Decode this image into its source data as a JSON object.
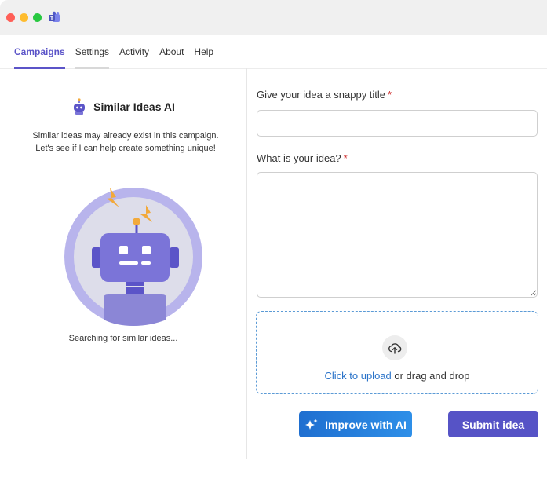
{
  "colors": {
    "accent": "#5b54c8",
    "background_brand": "#5b4fc7",
    "traffic_red": "#ff5f57",
    "traffic_yellow": "#febc2e",
    "traffic_green": "#28c840",
    "ai_button": "#1f6fd0",
    "submit_button": "#5653c6",
    "required": "#cc2222"
  },
  "tabs": [
    {
      "label": "Campaigns",
      "active": true
    },
    {
      "label": "Settings",
      "active": false
    },
    {
      "label": "Activity",
      "active": false
    },
    {
      "label": "About",
      "active": false
    },
    {
      "label": "Help",
      "active": false
    }
  ],
  "left_panel": {
    "title": "Similar Ideas AI",
    "description_line1": "Similar ideas may already exist in this campaign.",
    "description_line2": "Let's see if I can help create something unique!",
    "status": "Searching for similar ideas..."
  },
  "form": {
    "title_label": "Give your idea a snappy title",
    "title_value": "",
    "idea_label": "What is your idea?",
    "idea_value": "",
    "required_mark": "*",
    "upload_link": "Click to upload",
    "upload_rest": " or drag and drop",
    "improve_button": "Improve with AI",
    "submit_button": "Submit idea"
  },
  "icons": {
    "app": "teams-icon",
    "ai": "robot-icon",
    "upload": "upload-cloud-icon",
    "sparkle": "sparkle-icon"
  }
}
